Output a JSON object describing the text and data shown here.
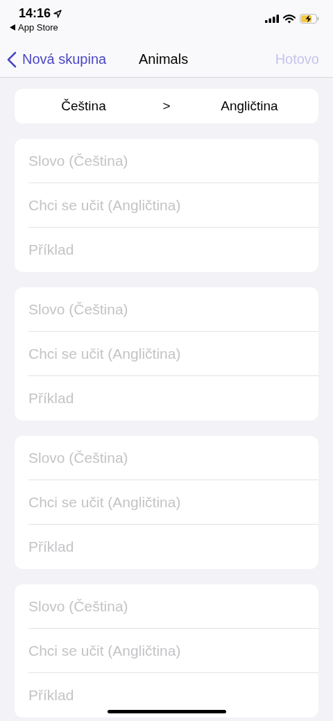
{
  "status_bar": {
    "time": "14:16",
    "back_app": "App Store"
  },
  "nav": {
    "back": "Nová skupina",
    "title": "Animals",
    "done": {
      "label": "Hotovo",
      "disabled": true
    }
  },
  "languages": {
    "from": "Čeština",
    "separator": ">",
    "to": "Angličtina"
  },
  "cards": [
    {
      "fields": [
        {
          "placeholder": "Slovo (Čeština)"
        },
        {
          "placeholder": "Chci se učit (Angličtina)"
        },
        {
          "placeholder": "Příklad"
        }
      ]
    },
    {
      "fields": [
        {
          "placeholder": "Slovo (Čeština)"
        },
        {
          "placeholder": "Chci se učit (Angličtina)"
        },
        {
          "placeholder": "Příklad"
        }
      ]
    },
    {
      "fields": [
        {
          "placeholder": "Slovo (Čeština)"
        },
        {
          "placeholder": "Chci se učit (Angličtina)"
        },
        {
          "placeholder": "Příklad"
        }
      ]
    },
    {
      "fields": [
        {
          "placeholder": "Slovo (Čeština)"
        },
        {
          "placeholder": "Chci se učit (Angličtina)"
        },
        {
          "placeholder": "Příklad"
        }
      ]
    }
  ]
}
